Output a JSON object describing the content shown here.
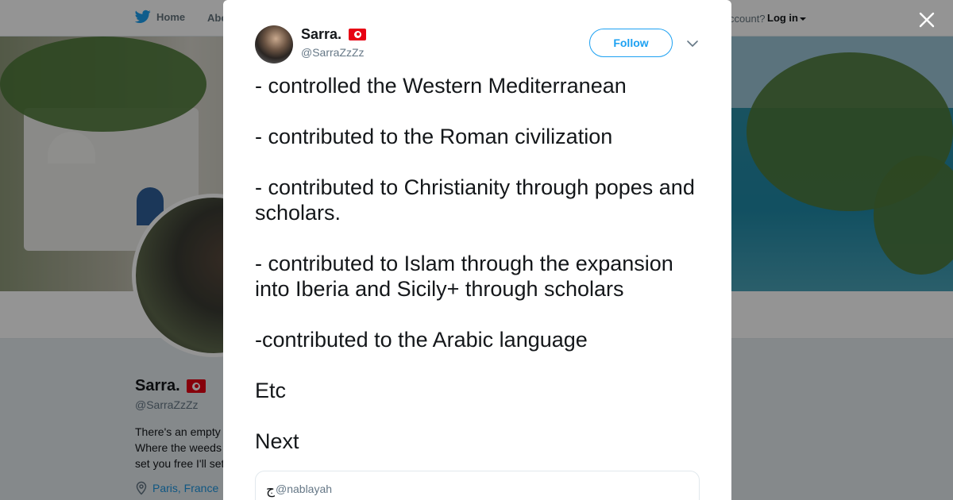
{
  "nav": {
    "home_label": "Home",
    "about_label": "Abo",
    "account_prompt": "ccount?",
    "login_label": "Log in"
  },
  "profile": {
    "name": "Sarra.",
    "flag_icon": "tunisia-flag-icon",
    "handle": "@SarraZzZz",
    "bio_lines": [
      "There's an empty",
      "Where the weeds",
      "set you free I'll set"
    ],
    "location": "Paris, France"
  },
  "tweet": {
    "author_name": "Sarra.",
    "author_handle": "@SarraZzZz",
    "follow_label": "Follow",
    "paragraphs": [
      "- controlled the Western Mediterranean",
      "- contributed to the Roman civilization",
      "- contributed to Christianity through popes and scholars.",
      "- contributed to Islam through the expansion into Iberia and Sicily+ through scholars",
      "-contributed to the Arabic language",
      "Etc",
      "Next"
    ],
    "quoted": {
      "name": "ج",
      "handle": "@nablayah"
    }
  },
  "colors": {
    "accent": "#1da1f2",
    "link": "#1b95e0",
    "text": "#14171a",
    "muted": "#657786",
    "flag_red": "#e70013"
  }
}
